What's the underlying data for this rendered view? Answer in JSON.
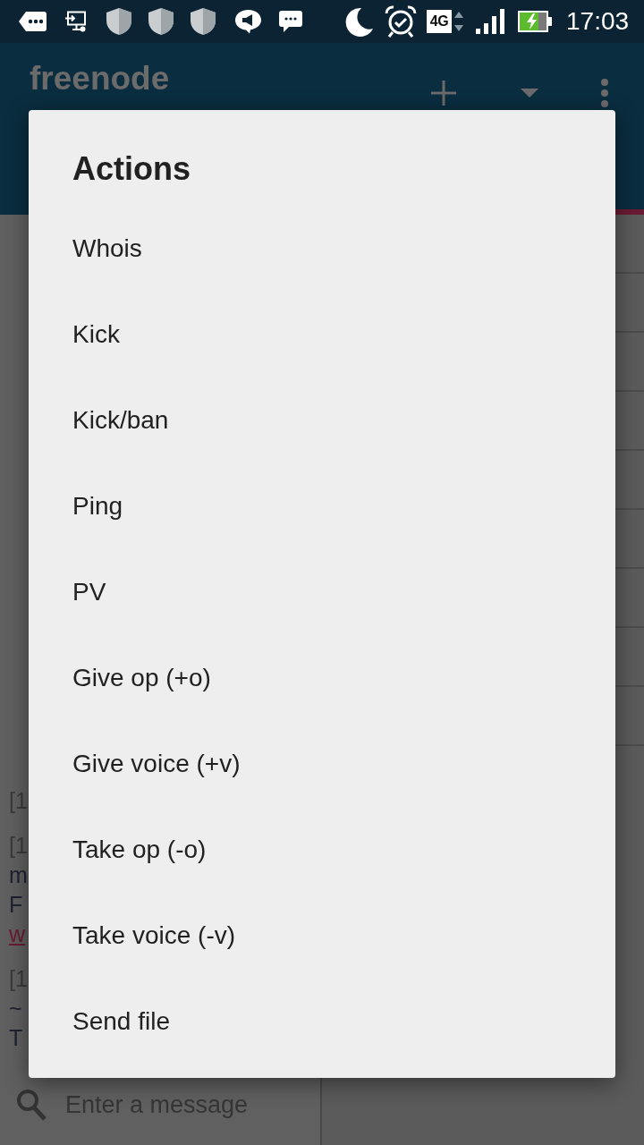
{
  "status_bar": {
    "network_type": "4G",
    "time": "17:03"
  },
  "app_bar": {
    "title": "freenode"
  },
  "chat": {
    "messages": [
      {
        "lines": [
          {
            "kind": "time",
            "text": "[1"
          }
        ]
      },
      {
        "lines": [
          {
            "kind": "time",
            "text": "[1"
          },
          {
            "kind": "text",
            "text": "m"
          },
          {
            "kind": "text",
            "text": "F"
          },
          {
            "kind": "link",
            "text": "w"
          }
        ]
      },
      {
        "lines": [
          {
            "kind": "time",
            "text": "[1"
          },
          {
            "kind": "text",
            "text": "~"
          },
          {
            "kind": "text",
            "text": "T"
          }
        ]
      }
    ],
    "input": {
      "placeholder": "Enter a message"
    }
  },
  "dialog": {
    "title": "Actions",
    "items": [
      "Whois",
      "Kick",
      "Kick/ban",
      "Ping",
      "PV",
      "Give op (+o)",
      "Give voice (+v)",
      "Take op (-o)",
      "Take voice (-v)",
      "Send file"
    ]
  }
}
